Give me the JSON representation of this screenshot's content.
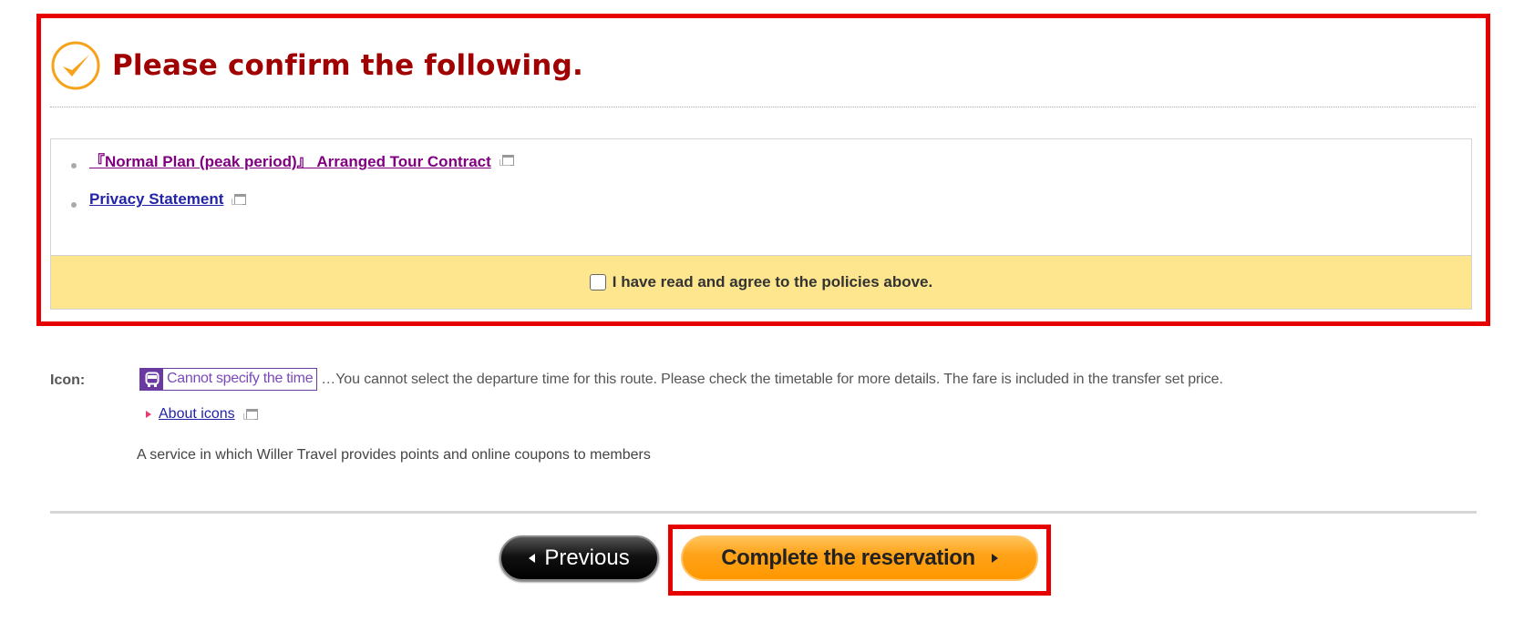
{
  "confirm": {
    "title": "Please confirm the following.",
    "policies": [
      {
        "label": "『Normal Plan (peak period)』 Arranged Tour Contract",
        "visited": true,
        "icon": "external-window-icon"
      },
      {
        "label": "Privacy Statement",
        "visited": false,
        "icon": "external-window-icon"
      }
    ],
    "agree_label": "I have read and agree to the policies above.",
    "agree_checked": false
  },
  "legend": {
    "label": "Icon:",
    "badge_text": "Cannot specify the time",
    "badge_icon": "bus-icon",
    "badge_description": "…You cannot select the departure time for this route. Please check the timetable for more details. The fare is included in the transfer set price.",
    "about_link": "About icons",
    "service_text": "A service in which Willer Travel provides points and online coupons to members"
  },
  "actions": {
    "previous_label": "Previous",
    "complete_label": "Complete the reservation"
  },
  "colors": {
    "highlight": "#e60000",
    "title": "#a00000",
    "agree_bg": "#fde68e",
    "badge": "#6a3aa0",
    "complete_button": "#ff9800"
  }
}
